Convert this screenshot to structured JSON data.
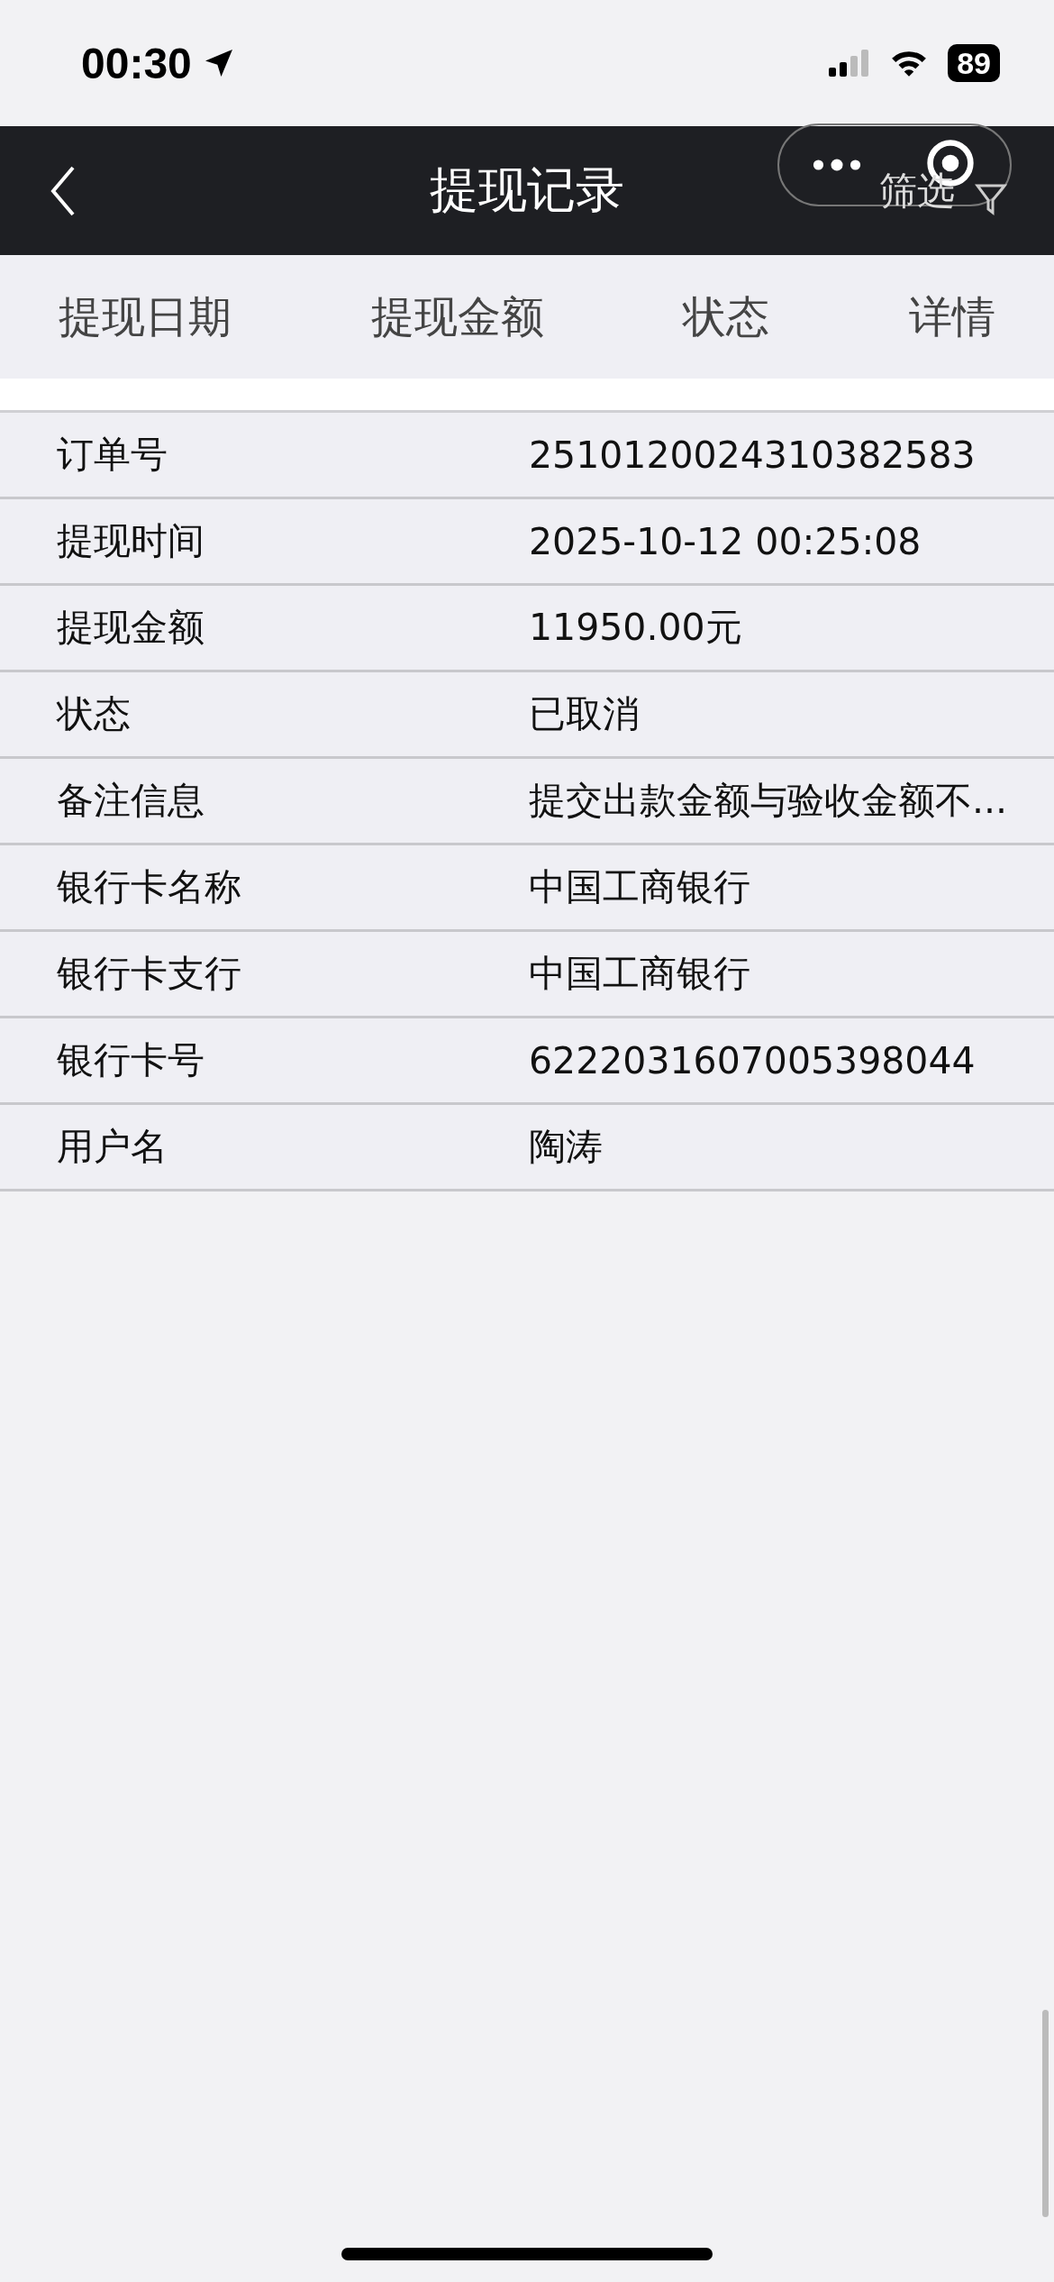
{
  "status_bar": {
    "time": "00:30",
    "battery": "89"
  },
  "nav_bar": {
    "title": "提现记录",
    "filter_label": "筛选"
  },
  "table": {
    "columns": [
      "提现日期",
      "提现金额",
      "状态",
      "详情"
    ]
  },
  "details": [
    {
      "label": "订单号",
      "value": "2510120024310382583"
    },
    {
      "label": "提现时间",
      "value": "2025-10-12 00:25:08"
    },
    {
      "label": "提现金额",
      "value": "11950.00元"
    },
    {
      "label": "状态",
      "value": "已取消"
    },
    {
      "label": "备注信息",
      "value": "提交出款金额与验收金额不..."
    },
    {
      "label": "银行卡名称",
      "value": "中国工商银行"
    },
    {
      "label": "银行卡支行",
      "value": "中国工商银行"
    },
    {
      "label": "银行卡号",
      "value": "6222031607005398044"
    },
    {
      "label": "用户名",
      "value": "陶涛"
    }
  ]
}
